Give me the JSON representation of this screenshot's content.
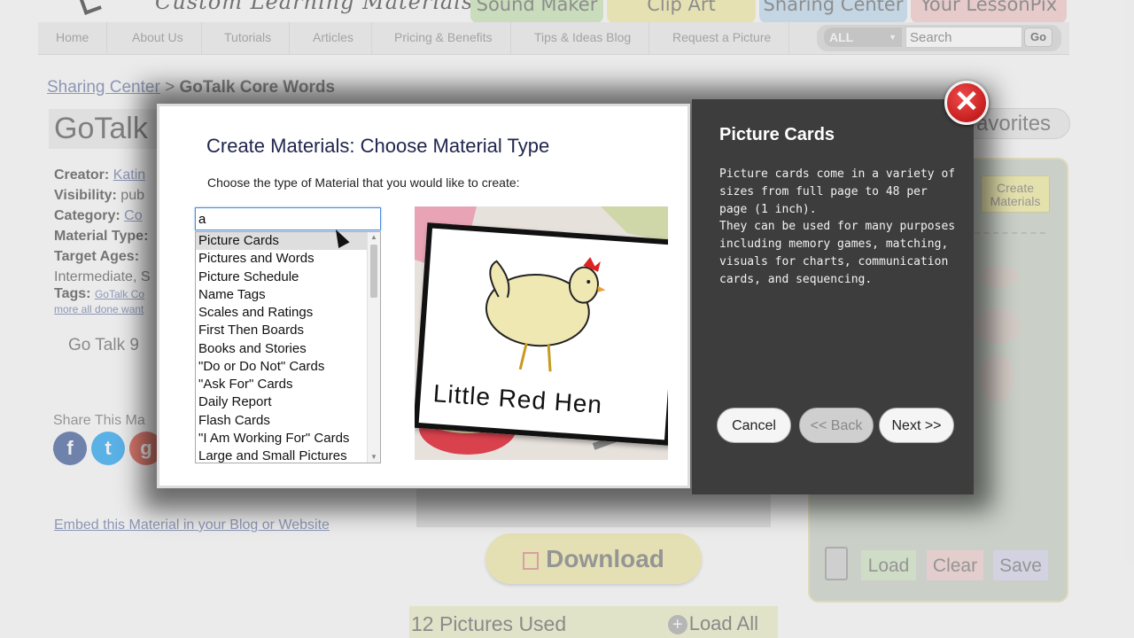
{
  "site": {
    "logo_text": "Custom Learning Materials",
    "top_tabs": [
      "Sound Maker",
      "Clip Art",
      "Sharing Center",
      "Your LessonPix"
    ]
  },
  "nav": {
    "items": [
      "Home",
      "About Us",
      "Tutorials",
      "Articles",
      "Pricing & Benefits",
      "Tips & Ideas Blog",
      "Request a Picture"
    ],
    "search_scope": "ALL",
    "search_placeholder": "Search",
    "go_label": "Go"
  },
  "breadcrumb": {
    "link": "Sharing Center",
    "separator": " > ",
    "current": "GoTalk Core Words"
  },
  "page": {
    "title": "GoTalk",
    "creator_label": "Creator:",
    "creator_value": "Katin",
    "visibility_label": "Visibility:",
    "visibility_value": "pub",
    "category_label": "Category:",
    "category_value": "Co",
    "material_type_label": "Material Type:",
    "target_ages_label": "Target Ages:",
    "target_ages_value": "Intermediate, S",
    "tags_label": "Tags:",
    "tags_value": "GoTalk Co",
    "tags_more": "more  all done  want",
    "gotalk_label": "Go Talk 9",
    "share_label": "Share This Ma",
    "embed_link": "Embed this Material in your Blog or Website",
    "download_label": "Download",
    "pictures_used": "12 Pictures Used",
    "load_all": "Load All",
    "favorites_label": "avorites",
    "create_materials": "Create Materials",
    "panel_buttons": [
      "Load",
      "Clear",
      "Save"
    ]
  },
  "modal": {
    "title": "Create Materials: Choose Material Type",
    "instruction": "Choose the type of Material that you would like to create:",
    "filter_value": "a",
    "material_types": [
      "Picture Cards",
      "Pictures and Words",
      "Picture Schedule",
      "Name Tags",
      "Scales and Ratings",
      "First Then Boards",
      "Books and Stories",
      "\"Do or Do Not\" Cards",
      "\"Ask For\" Cards",
      "Daily Report",
      "Flash Cards",
      "\"I Am Working For\" Cards",
      "Large and Small Pictures"
    ],
    "selected_index": 0,
    "preview_caption": "Little Red Hen",
    "info_title": "Picture Cards",
    "info_paragraphs": [
      "Picture cards come in a variety of sizes from full page to 48 per page (1 inch).",
      "They can be used for many purposes including memory games, matching, visuals for charts, communication cards, and sequencing."
    ],
    "cancel_label": "Cancel",
    "back_label": "<< Back",
    "next_label": "Next >>",
    "close_label": "✕"
  },
  "colors": {
    "modal_info_bg": "#3d3d3d",
    "title_color": "#20264e",
    "close_red": "#d11a1a"
  }
}
